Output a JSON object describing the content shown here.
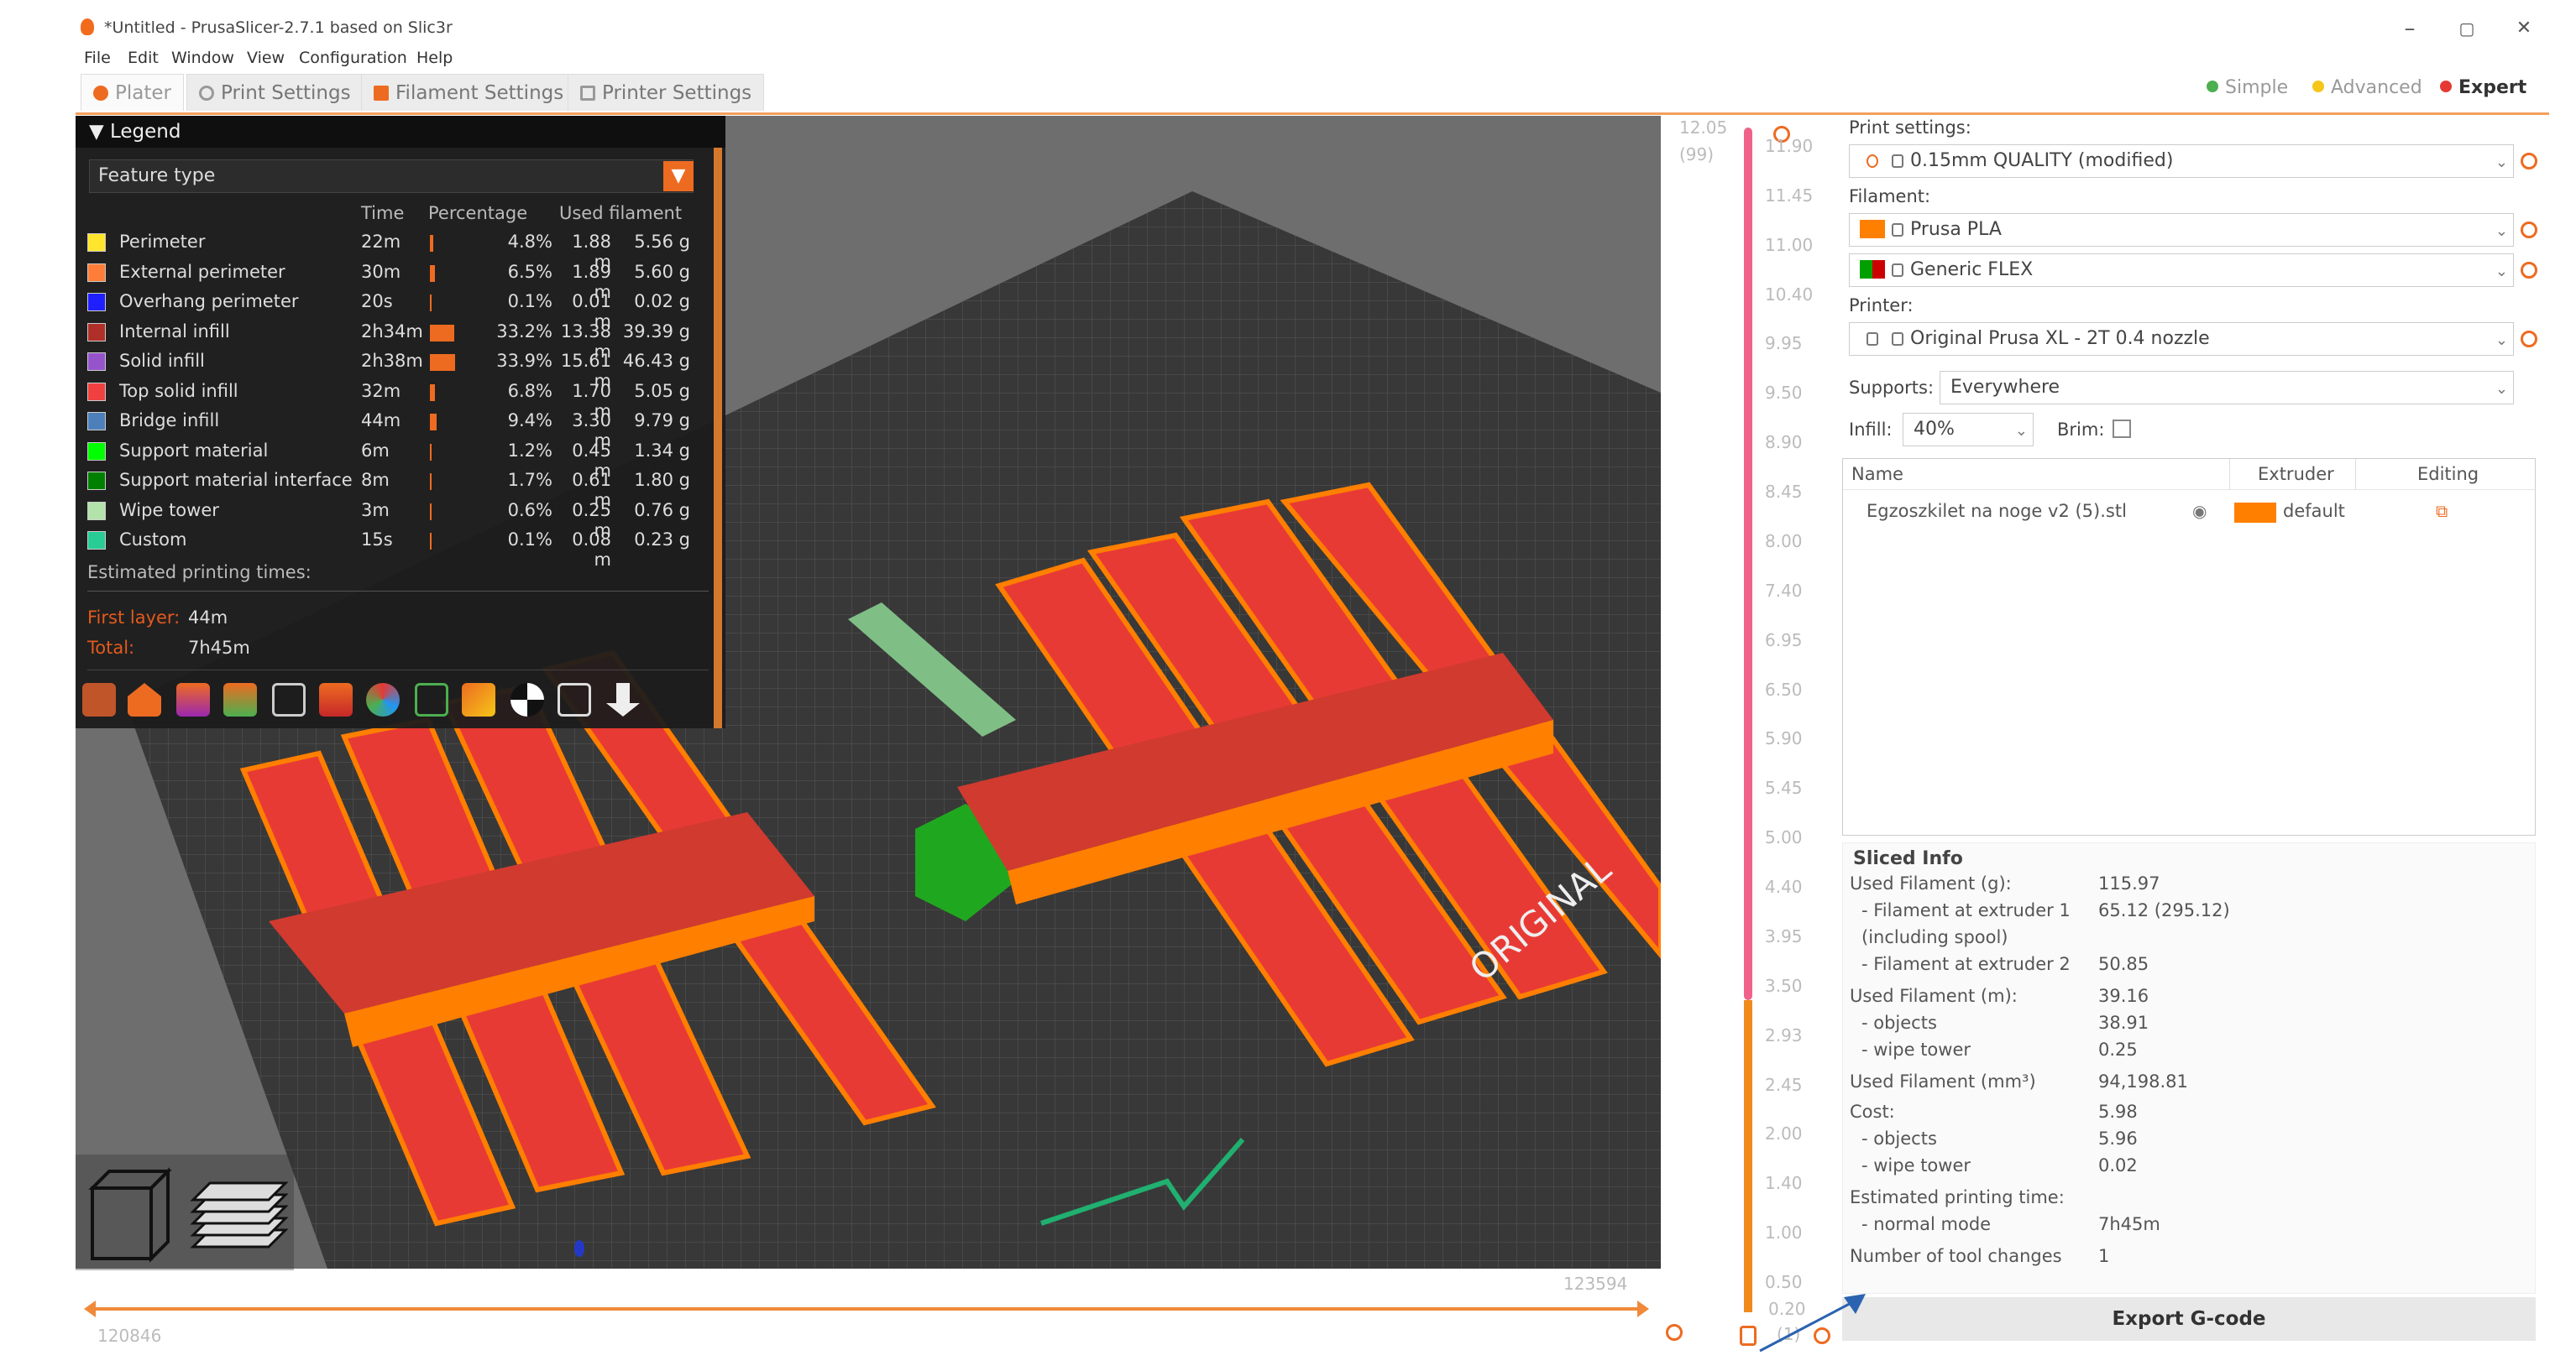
{
  "window": {
    "title": "*Untitled - PrusaSlicer-2.7.1 based on Slic3r",
    "controls": {
      "minimize": "–",
      "maximize": "▢",
      "close": "✕"
    }
  },
  "menu": [
    "File",
    "Edit",
    "Window",
    "View",
    "Configuration",
    "Help"
  ],
  "tabs": [
    "Plater",
    "Print Settings",
    "Filament Settings",
    "Printer Settings"
  ],
  "modes": [
    {
      "label": "Simple",
      "color": "#4caf50"
    },
    {
      "label": "Advanced",
      "color": "#f5c518"
    },
    {
      "label": "Expert",
      "color": "#e53935"
    }
  ],
  "legend": {
    "title": "Legend",
    "view_type": "Feature type",
    "columns": {
      "time": "Time",
      "percentage": "Percentage",
      "filament": "Used filament"
    },
    "rows": [
      {
        "name": "Perimeter",
        "color": "#ffe52b",
        "time": "22m",
        "percent": 4.8,
        "percentage": "4.8%",
        "meters": "1.88 m",
        "grams": "5.56 g"
      },
      {
        "name": "External perimeter",
        "color": "#ff7d38",
        "time": "30m",
        "percent": 6.5,
        "percentage": "6.5%",
        "meters": "1.89 m",
        "grams": "5.60 g"
      },
      {
        "name": "Overhang perimeter",
        "color": "#1f1fff",
        "time": "20s",
        "percent": 0.1,
        "percentage": "0.1%",
        "meters": "0.01 m",
        "grams": "0.02 g"
      },
      {
        "name": "Internal infill",
        "color": "#b03029",
        "time": "2h34m",
        "percent": 33.2,
        "percentage": "33.2%",
        "meters": "13.38 m",
        "grams": "39.39 g"
      },
      {
        "name": "Solid infill",
        "color": "#9654cc",
        "time": "2h38m",
        "percent": 33.9,
        "percentage": "33.9%",
        "meters": "15.61 m",
        "grams": "46.43 g"
      },
      {
        "name": "Top solid infill",
        "color": "#f04040",
        "time": "32m",
        "percent": 6.8,
        "percentage": "6.8%",
        "meters": "1.70 m",
        "grams": "5.05 g"
      },
      {
        "name": "Bridge infill",
        "color": "#4d80ba",
        "time": "44m",
        "percent": 9.4,
        "percentage": "9.4%",
        "meters": "3.30 m",
        "grams": "9.79 g"
      },
      {
        "name": "Support material",
        "color": "#00ff00",
        "time": "6m",
        "percent": 1.2,
        "percentage": "1.2%",
        "meters": "0.45 m",
        "grams": "1.34 g"
      },
      {
        "name": "Support material interface",
        "color": "#008000",
        "time": "8m",
        "percent": 1.7,
        "percentage": "1.7%",
        "meters": "0.61 m",
        "grams": "1.80 g"
      },
      {
        "name": "Wipe tower",
        "color": "#b3e3ab",
        "time": "3m",
        "percent": 0.6,
        "percentage": "0.6%",
        "meters": "0.25 m",
        "grams": "0.76 g"
      },
      {
        "name": "Custom",
        "color": "#28cc94",
        "time": "15s",
        "percent": 0.1,
        "percentage": "0.1%",
        "meters": "0.08 m",
        "grams": "0.23 g"
      }
    ],
    "estimated_label": "Estimated printing times:",
    "first_layer_label": "First layer:",
    "first_layer_value": "44m",
    "total_label": "Total:",
    "total_value": "7h45m"
  },
  "horizontal_slider": {
    "left_value": "120846",
    "right_value": "123594"
  },
  "vertical_slider": {
    "top_value": "12.05",
    "top_layer": "(99)",
    "bottom_value": "0.20",
    "bottom_layer": "(1)",
    "ticks": [
      "11.90",
      "11.45",
      "11.00",
      "10.40",
      "9.95",
      "9.50",
      "8.90",
      "8.45",
      "8.00",
      "7.40",
      "6.95",
      "6.50",
      "5.90",
      "5.45",
      "5.00",
      "4.40",
      "3.95",
      "3.50",
      "2.93",
      "2.45",
      "2.00",
      "1.40",
      "1.00",
      "0.50"
    ]
  },
  "bed": {
    "brand_text": "ORIGINAL"
  },
  "right_panel": {
    "print_settings_label": "Print settings:",
    "print_settings_value": "0.15mm QUALITY (modified)",
    "filament_label": "Filament:",
    "filaments": [
      {
        "name": "Prusa PLA",
        "color": "#ff7f00"
      },
      {
        "name": "Generic FLEX",
        "color": "#00a000"
      }
    ],
    "printer_label": "Printer:",
    "printer_value": "Original Prusa XL - 2T 0.4 nozzle",
    "supports_label": "Supports:",
    "supports_value": "Everywhere",
    "infill_label": "Infill:",
    "infill_value": "40%",
    "brim_label": "Brim:",
    "object_list": {
      "columns": {
        "name": "Name",
        "extruder": "Extruder",
        "editing": "Editing"
      },
      "items": [
        {
          "name": "Egzoszkilet na noge v2 (5).stl",
          "extruder": "default",
          "extruder_color": "#ff7f00"
        }
      ]
    }
  },
  "sliced_info": {
    "title": "Sliced Info",
    "rows": [
      {
        "label": "Used Filament (g):",
        "value": "115.97"
      },
      {
        "label": "- Filament at extruder 1",
        "value": "65.12 (295.12)"
      },
      {
        "label": "(including spool)",
        "value": ""
      },
      {
        "label": "- Filament at extruder 2",
        "value": "50.85"
      },
      {
        "label": "Used Filament (m):",
        "value": "39.16"
      },
      {
        "label": "- objects",
        "value": "38.91"
      },
      {
        "label": "- wipe tower",
        "value": "0.25"
      },
      {
        "label": "Used Filament (mm³)",
        "value": "94,198.81"
      },
      {
        "label": "Cost:",
        "value": "5.98"
      },
      {
        "label": "- objects",
        "value": "5.96"
      },
      {
        "label": "- wipe tower",
        "value": "0.02"
      },
      {
        "label": "Estimated printing time:",
        "value": ""
      },
      {
        "label": "- normal mode",
        "value": "7h45m"
      },
      {
        "label": "Number of tool changes",
        "value": "1"
      }
    ]
  },
  "export_button": "Export G-code"
}
